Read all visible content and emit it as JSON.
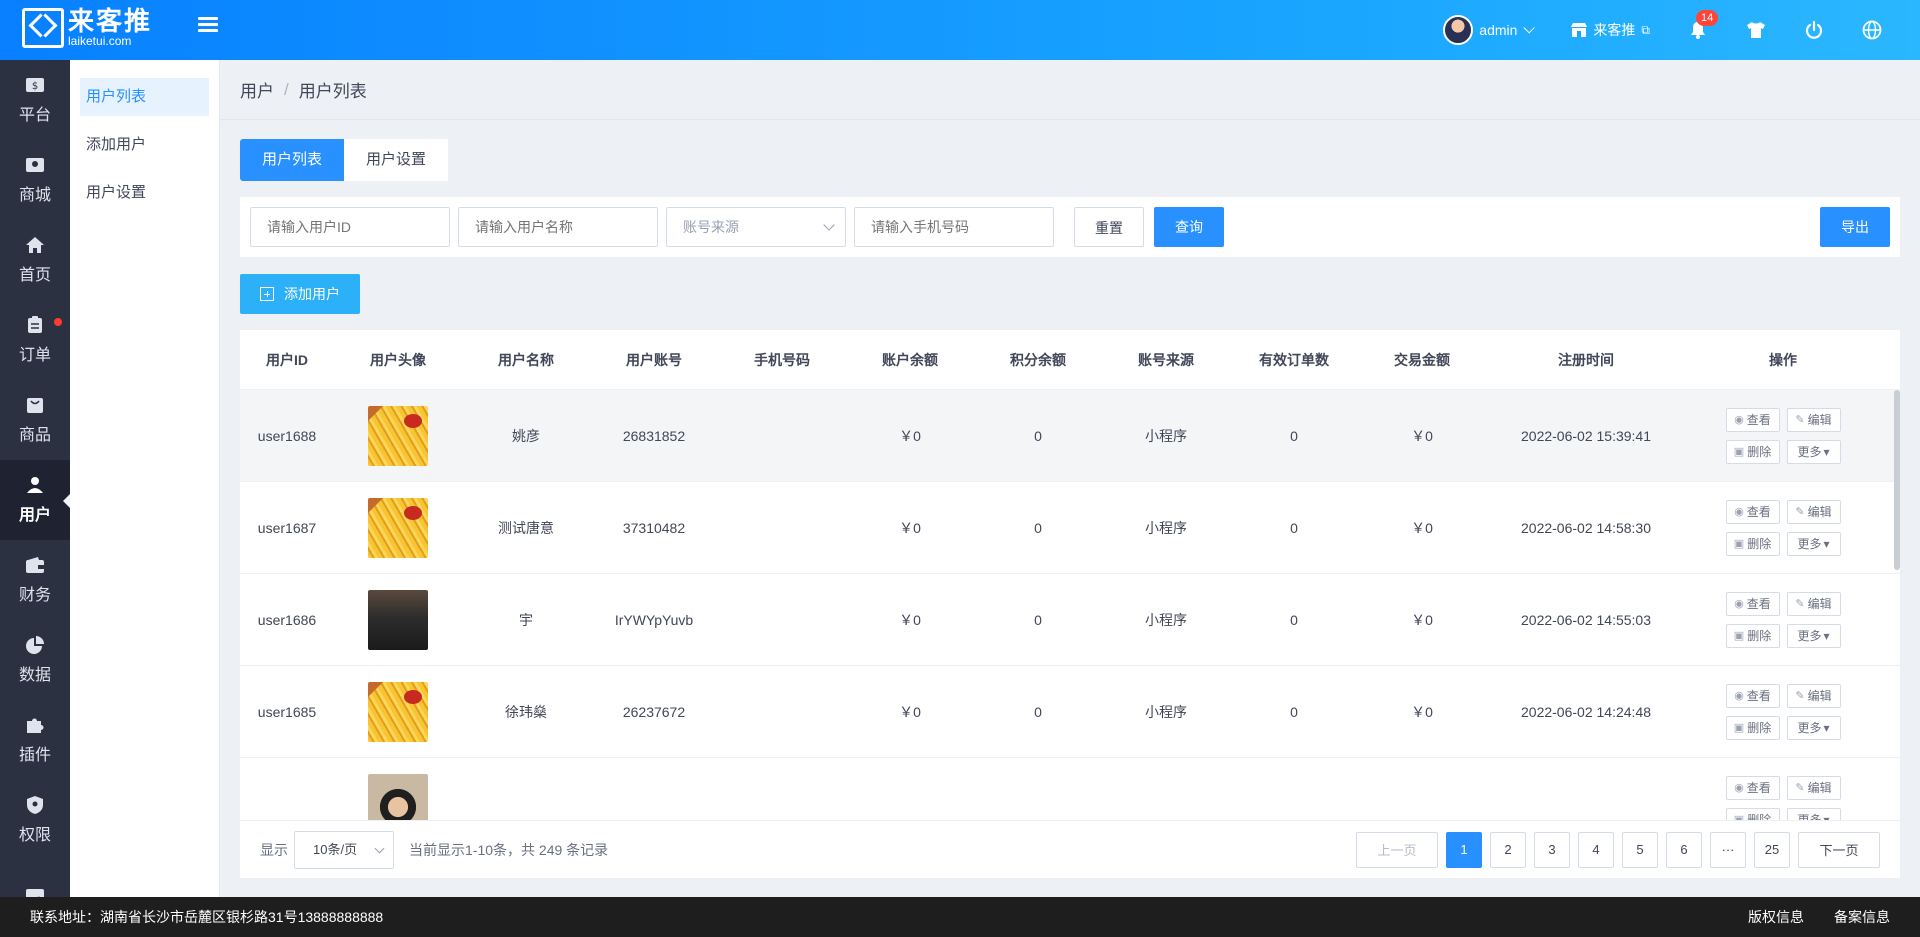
{
  "brand": {
    "name_cn": "来客推",
    "name_en": "laiketui.com"
  },
  "topbar": {
    "user": "admin",
    "store": "来客推",
    "notifications": 14
  },
  "sidebar": [
    {
      "label": "平台",
      "icon": "platform-icon"
    },
    {
      "label": "商城",
      "icon": "mall-icon"
    },
    {
      "label": "首页",
      "icon": "home-icon"
    },
    {
      "label": "订单",
      "icon": "order-icon",
      "dot": true
    },
    {
      "label": "商品",
      "icon": "goods-icon"
    },
    {
      "label": "用户",
      "icon": "user-icon",
      "active": true
    },
    {
      "label": "财务",
      "icon": "wallet-icon"
    },
    {
      "label": "数据",
      "icon": "pie-chart-icon"
    },
    {
      "label": "插件",
      "icon": "puzzle-icon"
    },
    {
      "label": "权限",
      "icon": "shield-icon"
    },
    {
      "label": "",
      "icon": "image-icon"
    }
  ],
  "subnav": [
    "用户列表",
    "添加用户",
    "用户设置"
  ],
  "breadcrumb": {
    "root": "用户",
    "sep": "/",
    "current": "用户列表"
  },
  "tabs": [
    "用户列表",
    "用户设置"
  ],
  "filter": {
    "id_placeholder": "请输入用户ID",
    "name_placeholder": "请输入用户名称",
    "source_placeholder": "账号来源",
    "phone_placeholder": "请输入手机号码",
    "reset": "重置",
    "query": "查询",
    "export": "导出"
  },
  "add_user": "添加用户",
  "table": {
    "headers": [
      "用户ID",
      "用户头像",
      "用户名称",
      "用户账号",
      "手机号码",
      "账户余额",
      "积分余额",
      "账号来源",
      "有效订单数",
      "交易金额",
      "注册时间",
      "操作"
    ],
    "rows": [
      {
        "id": "user1688",
        "avatar": "fries",
        "name": "姚彦",
        "account": "26831852",
        "phone": "",
        "balance": "￥0",
        "points": "0",
        "source": "小程序",
        "orders": "0",
        "amount": "￥0",
        "time": "2022-06-02 15:39:41"
      },
      {
        "id": "user1687",
        "avatar": "fries",
        "name": "测试唐意",
        "account": "37310482",
        "phone": "",
        "balance": "￥0",
        "points": "0",
        "source": "小程序",
        "orders": "0",
        "amount": "￥0",
        "time": "2022-06-02 14:58:30"
      },
      {
        "id": "user1686",
        "avatar": "dark",
        "name": "宇",
        "account": "IrYWYpYuvb",
        "phone": "",
        "balance": "￥0",
        "points": "0",
        "source": "小程序",
        "orders": "0",
        "amount": "￥0",
        "time": "2022-06-02 14:55:03"
      },
      {
        "id": "user1685",
        "avatar": "fries",
        "name": "徐玮燊",
        "account": "26237672",
        "phone": "",
        "balance": "￥0",
        "points": "0",
        "source": "小程序",
        "orders": "0",
        "amount": "￥0",
        "time": "2022-06-02 14:24:48"
      },
      {
        "id": "",
        "avatar": "person",
        "name": "",
        "account": "",
        "phone": "",
        "balance": "",
        "points": "",
        "source": "",
        "orders": "",
        "amount": "",
        "time": ""
      }
    ],
    "ops": {
      "view": "查看",
      "edit": "编辑",
      "delete": "删除",
      "more": "更多"
    }
  },
  "pager": {
    "show": "显示",
    "page_size": "10条/页",
    "summary": "当前显示1-10条，共 249 条记录",
    "prev": "上一页",
    "pages": [
      "1",
      "2",
      "3",
      "4",
      "5",
      "6",
      "···",
      "25"
    ],
    "next": "下一页"
  },
  "footer": {
    "address": "联系地址：湖南省长沙市岳麓区银杉路31号13888888888",
    "copyright": "版权信息",
    "icp": "备案信息"
  }
}
